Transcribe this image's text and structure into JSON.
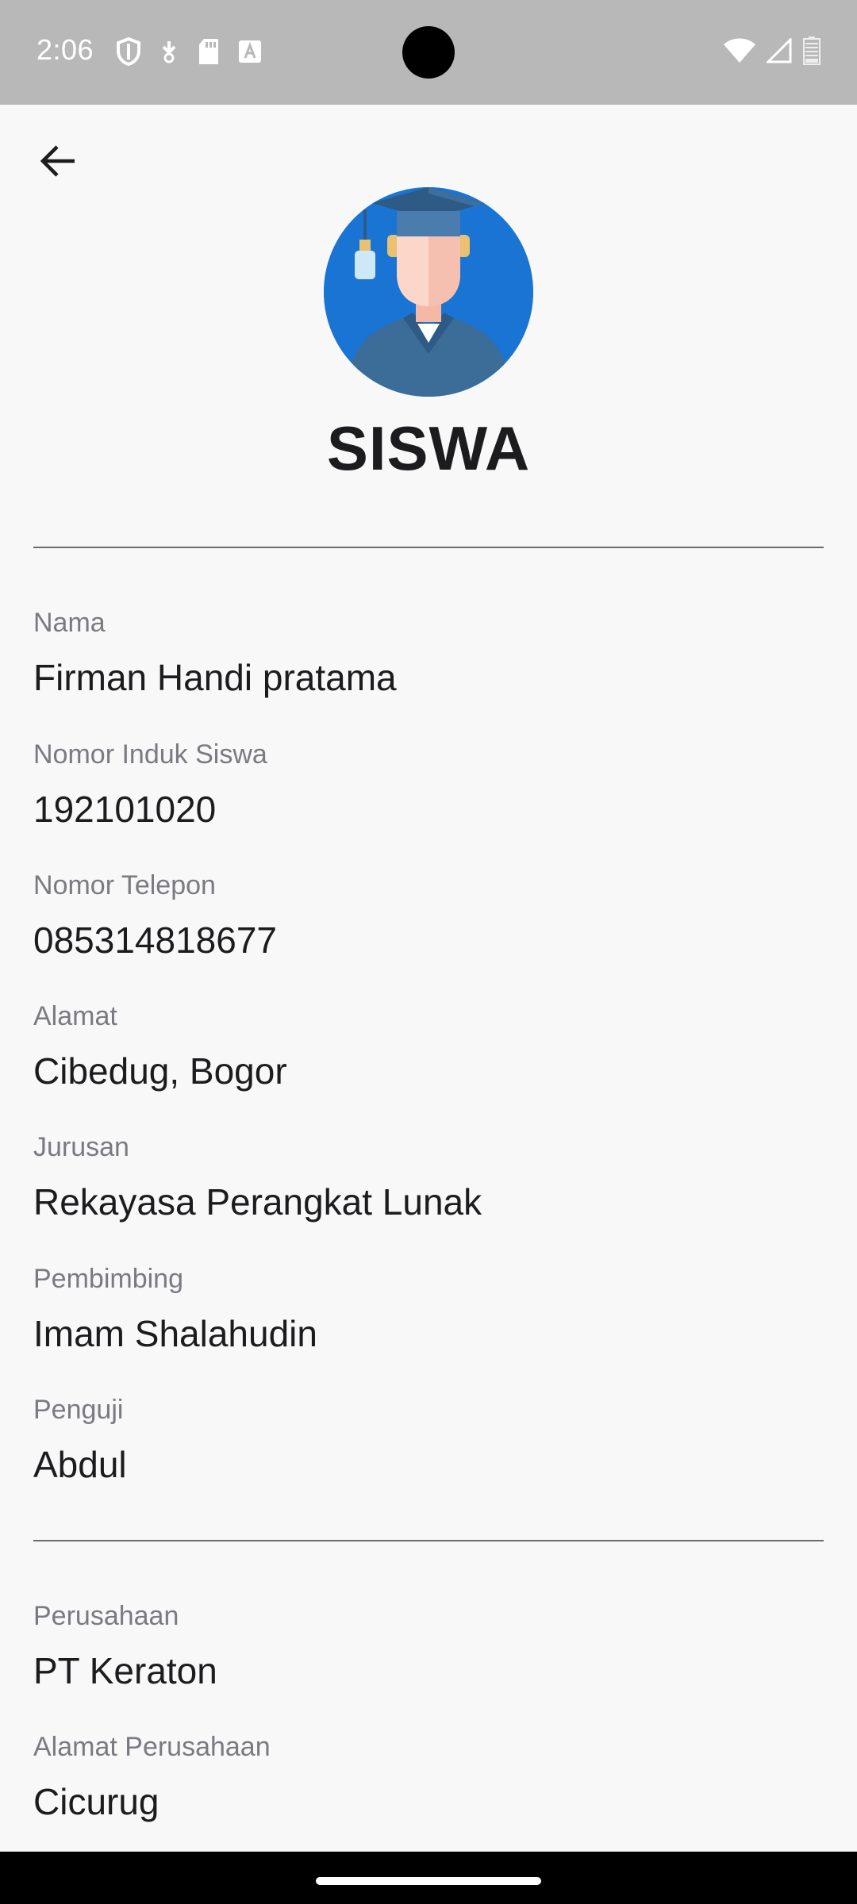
{
  "status_bar": {
    "time": "2:06",
    "left_icons": [
      "shield-icon",
      "download-icon",
      "sd-card-icon",
      "font-a-icon"
    ],
    "right_icons": [
      "wifi-icon",
      "cell-signal-icon",
      "battery-icon"
    ]
  },
  "header": {
    "back_icon": "arrow-left-icon",
    "avatar_icon": "graduate-avatar-icon",
    "title": "SISWA"
  },
  "student": {
    "fields": [
      {
        "label": "Nama",
        "value": "Firman Handi pratama"
      },
      {
        "label": "Nomor Induk Siswa",
        "value": "192101020"
      },
      {
        "label": "Nomor Telepon",
        "value": "085314818677"
      },
      {
        "label": "Alamat",
        "value": "Cibedug, Bogor"
      },
      {
        "label": "Jurusan",
        "value": "Rekayasa Perangkat Lunak"
      },
      {
        "label": "Pembimbing",
        "value": "Imam Shalahudin"
      },
      {
        "label": "Penguji",
        "value": "Abdul"
      }
    ]
  },
  "company": {
    "fields": [
      {
        "label": "Perusahaan",
        "value": "PT Keraton"
      },
      {
        "label": "Alamat Perusahaan",
        "value": "Cicurug"
      }
    ]
  },
  "colors": {
    "accent": "#1a74d4",
    "background": "#f8f8f9",
    "status_bar": "#b8b8b8",
    "label": "#7a7a80",
    "value": "#1c1c1e"
  }
}
